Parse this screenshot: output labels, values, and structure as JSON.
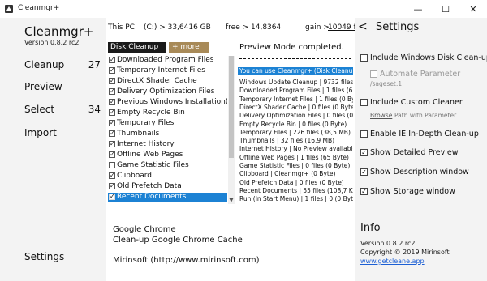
{
  "window": {
    "title": "Cleanmgr+",
    "icon": "broom-icon",
    "minimize": "—",
    "maximize": "☐",
    "close": "✕"
  },
  "sidebar": {
    "app_name": "Cleanmgr+",
    "version": "Version 0.8.2 rc2",
    "items": [
      {
        "label": "Cleanup",
        "count": "27"
      },
      {
        "label": "Preview",
        "count": ""
      },
      {
        "label": "Select",
        "count": "34"
      },
      {
        "label": "Import",
        "count": ""
      }
    ],
    "settings_label": "Settings"
  },
  "stats": {
    "pc_label": "This PC",
    "drive": "(C:) > 33,6416 GB",
    "free": "free > 14,8364",
    "gain_label": "gain >",
    "gain_value": "10049 fil"
  },
  "toolbar": {
    "disk_cleanup_label": "Disk Cleanup",
    "more_label": "+ more"
  },
  "cleanup_list": [
    {
      "label": "Downloaded Program Files",
      "checked": true
    },
    {
      "label": "Temporary Internet Files",
      "checked": true
    },
    {
      "label": "DirectX Shader Cache",
      "checked": true
    },
    {
      "label": "Delivery Optimization Files",
      "checked": true
    },
    {
      "label": "Previous Windows Installation(s)",
      "checked": true
    },
    {
      "label": "Empty Recycle Bin",
      "checked": true
    },
    {
      "label": "Temporary Files",
      "checked": true
    },
    {
      "label": "Thumbnails",
      "checked": true
    },
    {
      "label": "Internet History",
      "checked": true
    },
    {
      "label": "Offline Web Pages",
      "checked": true
    },
    {
      "label": "Game Statistic Files",
      "checked": false
    },
    {
      "label": "Clipboard",
      "checked": true
    },
    {
      "label": "Old Prefetch Data",
      "checked": true
    },
    {
      "label": "Recent Documents",
      "checked": true,
      "selected": true
    }
  ],
  "preview": {
    "status": "Preview Mode completed.",
    "highlight": "You can use Cleanmgr+ (Disk Cleanup data",
    "lines": [
      "Windows Update Cleanup | 9732 files (213",
      "Downloaded Program Files | 1 files (65 Byte",
      "Temporary Internet Files | 1 files (0 Byte)",
      "DirectX Shader Cache | 0 files (0 Byte)",
      "Delivery Optimization Files | 0 files (0 Byte)",
      "Empty Recycle Bin | 0 files (0 Byte)",
      "Temporary Files | 226 files (38,5 MB)",
      "Thumbnails | 32 files (16,9 MB)",
      "Internet History | No Preview available",
      "Offline Web Pages | 1 files (65 Byte)",
      "Game Statistic Files | 0 files (0 Byte)",
      "Clipboard | Cleanmgr+ (0 Byte)",
      "Old Prefetch Data | 0 files (0 Byte)",
      "Recent Documents | 55 files (108,7 KB)",
      "Run (In Start Menu) | 1 files | 0 (0 Byte)"
    ]
  },
  "description": {
    "title": "Google Chrome",
    "subtitle": "Clean-up Google Chrome Cache",
    "author": "Mirinsoft (http://www.mirinsoft.com)"
  },
  "settings": {
    "title": "Settings",
    "back_icon": "arrow-left-icon",
    "options": [
      {
        "label": "Include Windows Disk Clean-up",
        "checked": false,
        "disabled": false
      },
      {
        "label": "Automate Parameter",
        "checked": false,
        "disabled": true
      },
      {
        "label": "Include Custom Cleaner",
        "checked": false,
        "disabled": false
      },
      {
        "label": "Enable IE In-Depth Clean-up",
        "checked": false,
        "disabled": false
      },
      {
        "label": "Show Detailed Preview",
        "checked": true,
        "disabled": false
      },
      {
        "label": "Show Description window",
        "checked": true,
        "disabled": false
      },
      {
        "label": "Show Storage window",
        "checked": true,
        "disabled": false
      }
    ],
    "sageset": "/sageset:1",
    "browse_label": "Browse",
    "browse_hint": "Path with Parameter"
  },
  "info": {
    "title": "Info",
    "version": "Version 0.8.2 rc2",
    "copyright": "Copyright © 2019 Mirinsoft",
    "link": "www.getcleane.app"
  },
  "colors": {
    "accent": "#1c82d4",
    "more_button": "#a88a58",
    "panel": "#f3f3f3"
  }
}
